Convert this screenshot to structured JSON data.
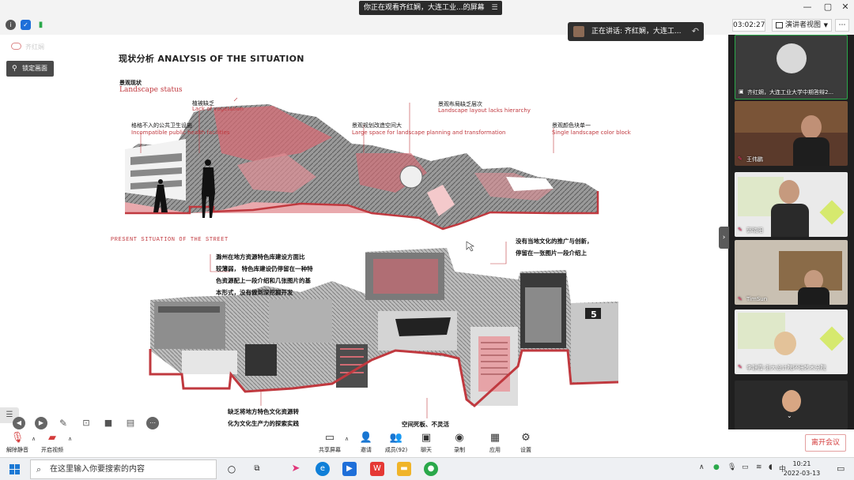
{
  "window": {
    "share_notice": "你正在观看齐红娴，大连工业...的屏幕",
    "controls": [
      "—",
      "▢",
      "✕"
    ]
  },
  "meeting_bar": {
    "timer": "03:02:27",
    "view_label": "演讲者视图",
    "speaking_toast": "正在讲话: 齐红娴，大连工..."
  },
  "overlay": {
    "watermark": "齐红娴",
    "lock_label": "锁定画面"
  },
  "slide": {
    "title": "现状分析 ANALYSIS OF THE SITUATION",
    "status_cn": "景观现状",
    "status_en": "Landscape status",
    "labels": [
      {
        "cn": "植被缺乏",
        "en": "Lack of vegetation"
      },
      {
        "cn": "格格不入的公共卫生设施",
        "en": "Incompatible public health facilities"
      },
      {
        "cn": "景观规划改造空间大",
        "en": "Large space for landscape planning and transformation"
      },
      {
        "cn": "景观布局缺乏层次",
        "en": "Landscape layout lacks hierarchy"
      },
      {
        "cn": "景观颜色块单一",
        "en": "Single landscape color block"
      }
    ],
    "street_title": "PRESENT SITUATION OF THE STREET",
    "note_library": [
      "滁州在地方资源特色库建设方面比",
      "较薄弱，  特色库建设仍停留在一种特",
      "色资源配上一段介绍和几张图片的基",
      "本形式，没有做到深挖掘开发"
    ],
    "note_culture": [
      "没有当地文化的推广与创新，",
      "停留在一张图片一段介绍上"
    ],
    "note_bottom_left": [
      "缺乏将地方特色文化资源转",
      "化为文化生产力的探索实践"
    ],
    "note_bottom_mid": "空间死板、不灵活",
    "booth_number": "5"
  },
  "participants": [
    {
      "name": "齐红娴，大连工业大学中期答辩2..."
    },
    {
      "name": "王伟鹏"
    },
    {
      "name": "郭晓阳"
    },
    {
      "name": "TimSun"
    },
    {
      "name": "李静霞-浙大设计院环境艺术分院"
    },
    {
      "name": ""
    }
  ],
  "toolbar": {
    "unmute": "解除静音",
    "start_video": "开启视频",
    "share": "共享屏幕",
    "invite": "邀请",
    "members": "成员(92)",
    "chat": "聊天",
    "record": "录制",
    "apps": "应用",
    "settings": "设置",
    "leave": "离开会议"
  },
  "taskbar": {
    "search_placeholder": "在这里输入你要搜索的内容",
    "time": "10:21",
    "date": "2022-03-13",
    "ime": "中"
  },
  "colors": {
    "accent_red": "#c0393f",
    "panel_bg": "#1f1f1f",
    "leave_red": "#d43c3c"
  }
}
